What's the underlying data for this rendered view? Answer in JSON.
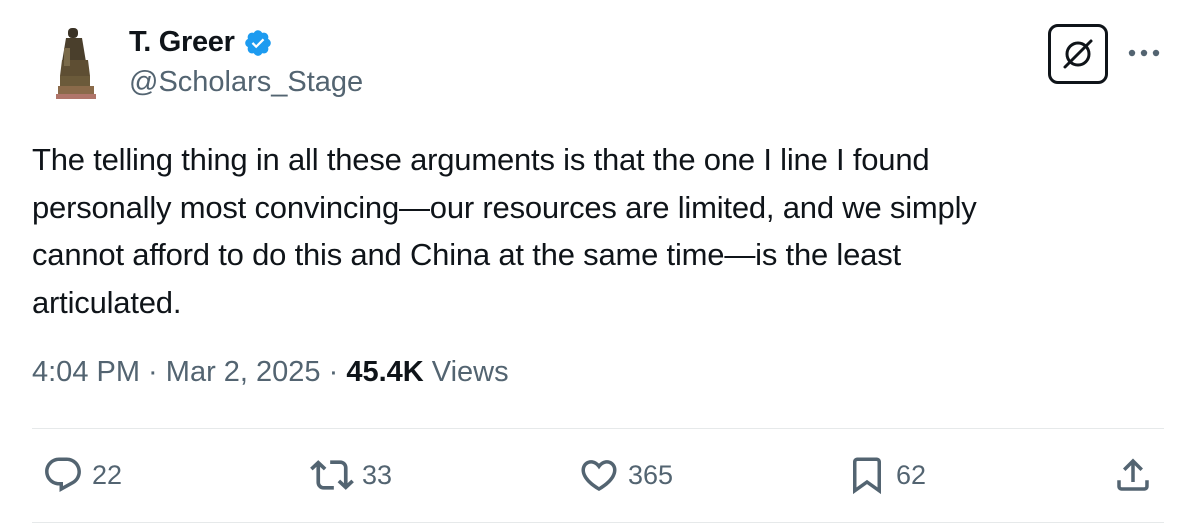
{
  "author": {
    "name": "T. Greer",
    "handle": "@Scholars_Stage",
    "verified": true
  },
  "tweet": {
    "text": "The telling thing in all these arguments is that the one I line I found\npersonally most convincing—our resources are limited, and we  simply\ncannot afford to do this and China at the same time—is the least\narticulated."
  },
  "meta": {
    "time": "4:04 PM",
    "separator": " · ",
    "date": "Mar 2, 2025",
    "views_count": "45.4K",
    "views_label": " Views"
  },
  "actions": {
    "replies": "22",
    "reposts": "33",
    "likes": "365",
    "bookmarks": "62"
  },
  "colors": {
    "text": "#0f1419",
    "secondary": "#536471",
    "verified": "#1d9bf0",
    "divider": "#e6e9ea"
  }
}
